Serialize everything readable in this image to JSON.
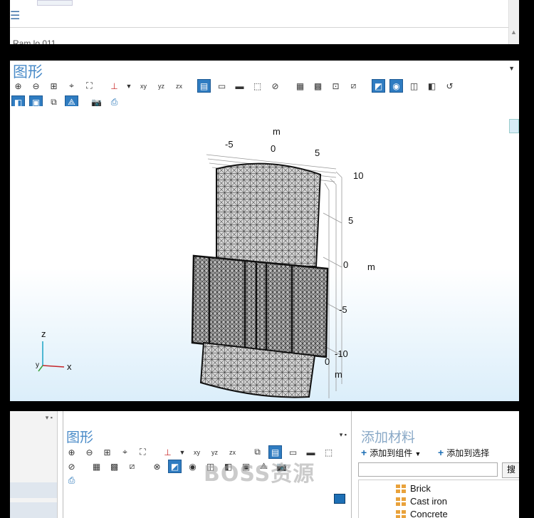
{
  "top_panel": {
    "section_label": "Ram lo 011"
  },
  "graphics_panel": {
    "title": "图形",
    "axis_labels": {
      "top_unit": "m",
      "top_ticks": [
        "-5",
        "0",
        "5"
      ],
      "right_ticks": [
        "10",
        "5",
        "0",
        "-5",
        "-10"
      ],
      "right_unit": "m",
      "bottom_tick": "0",
      "bottom_unit": "m"
    },
    "triad": {
      "z": "z",
      "y": "y",
      "x": "x"
    }
  },
  "bottom_graphics": {
    "title": "图形"
  },
  "materials_panel": {
    "title": "添加材料",
    "add_to_component": "添加到组件",
    "add_to_selection": "添加到选择",
    "search_button": "搜",
    "materials": [
      "Brick",
      "Cast iron",
      "Concrete"
    ]
  },
  "watermark": "BOSS资源"
}
